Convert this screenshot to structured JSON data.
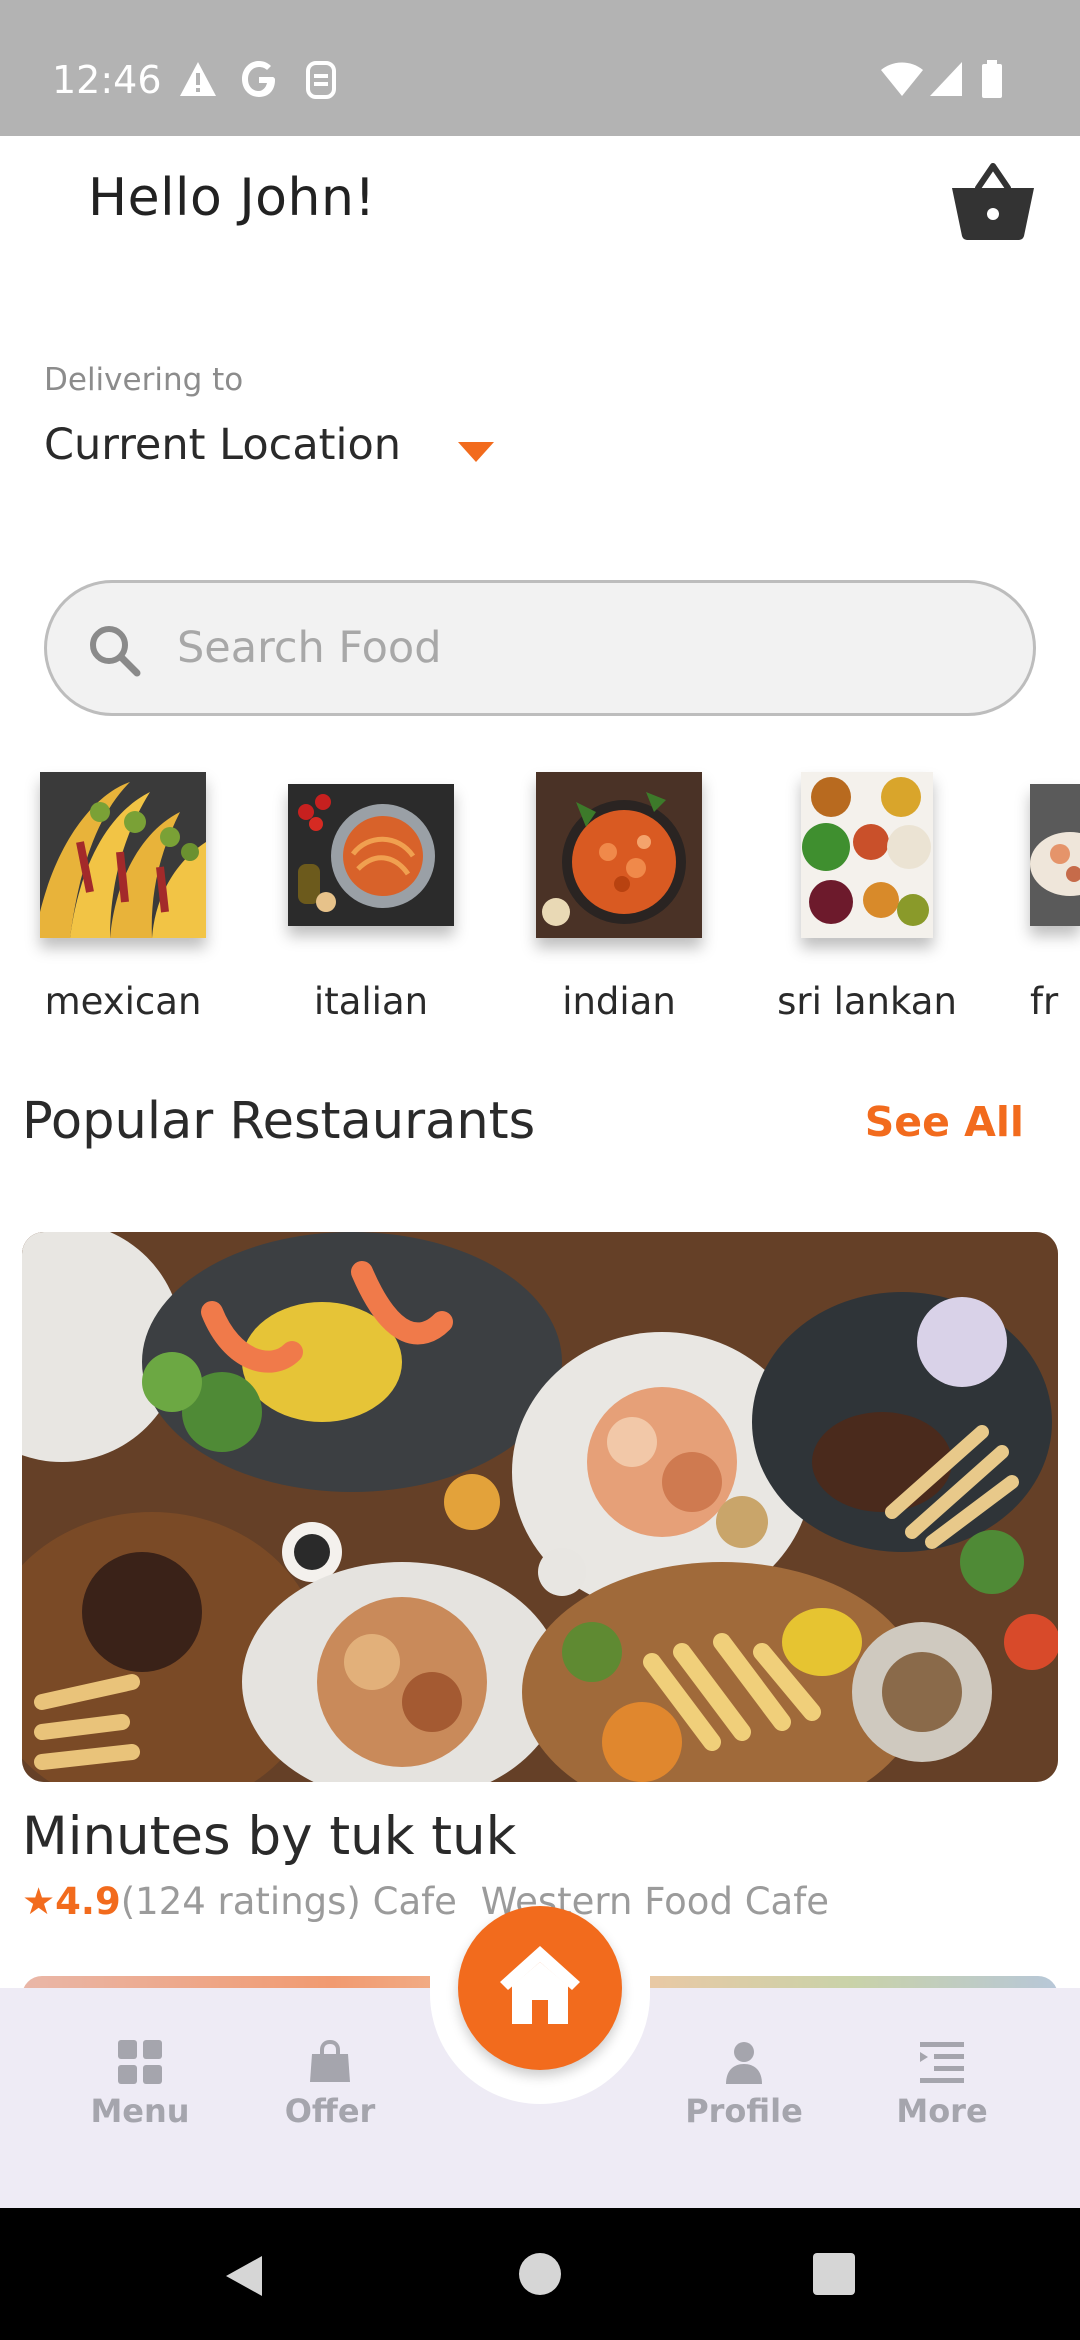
{
  "status_bar": {
    "time": "12:46"
  },
  "header": {
    "greeting": "Hello John!"
  },
  "delivery": {
    "label": "Delivering to",
    "location": "Current Location"
  },
  "search": {
    "placeholder": "Search Food"
  },
  "categories": [
    {
      "label": "mexican"
    },
    {
      "label": "italian"
    },
    {
      "label": "indian"
    },
    {
      "label": "sri lankan"
    },
    {
      "label": "fr"
    }
  ],
  "popular": {
    "title": "Popular Restaurants",
    "see_all": "See All"
  },
  "restaurant": {
    "name": "Minutes by tuk tuk",
    "rating": "4.9",
    "ratings_count": "(124 ratings)",
    "type": "Cafe",
    "cuisine": "Western Food Cafe"
  },
  "bottom_nav": {
    "menu": "Menu",
    "offer": "Offer",
    "profile": "Profile",
    "more": "More"
  },
  "colors": {
    "accent": "#f26b1d",
    "nav_background": "#eeebf5",
    "status_bar": "#b3b3b3"
  }
}
